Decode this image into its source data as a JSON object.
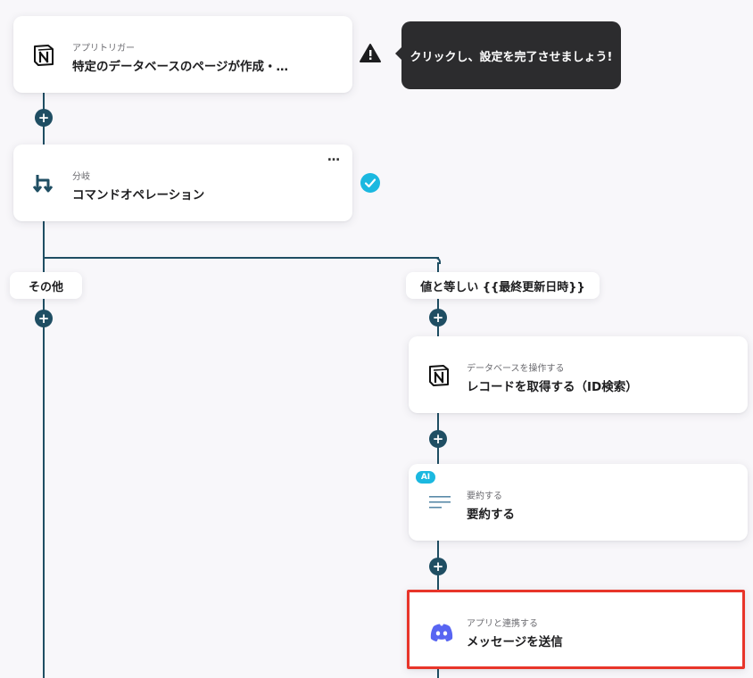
{
  "trigger": {
    "subtitle": "アプリトリガー",
    "title": "特定のデータベースのページが作成・…",
    "icon": "notion-icon"
  },
  "warning": {
    "icon": "warning-icon",
    "tooltip": "クリックし、設定を完了させましょう!"
  },
  "branch": {
    "subtitle": "分岐",
    "title": "コマンドオペレーション",
    "menu": "…",
    "icon": "branch-icon",
    "status_icon": "check-circle-icon"
  },
  "branches": {
    "other_label": "その他",
    "match_label": "値と等しい {{最終更新日時}}"
  },
  "steps": [
    {
      "subtitle": "データベースを操作する",
      "title": "レコードを取得する（ID検索）",
      "icon": "notion-icon"
    },
    {
      "subtitle": "要約する",
      "title": "要約する",
      "badge": "AI",
      "icon": "summary-icon"
    },
    {
      "subtitle": "アプリと連携する",
      "title": "メッセージを送信",
      "icon": "discord-icon"
    }
  ],
  "colors": {
    "connector": "#1f4e63",
    "highlight": "#e8352a",
    "check": "#1bb8e0",
    "ai_badge": "#1bb8e0",
    "discord": "#5865f2",
    "tooltip_bg": "#2c2c2e"
  }
}
